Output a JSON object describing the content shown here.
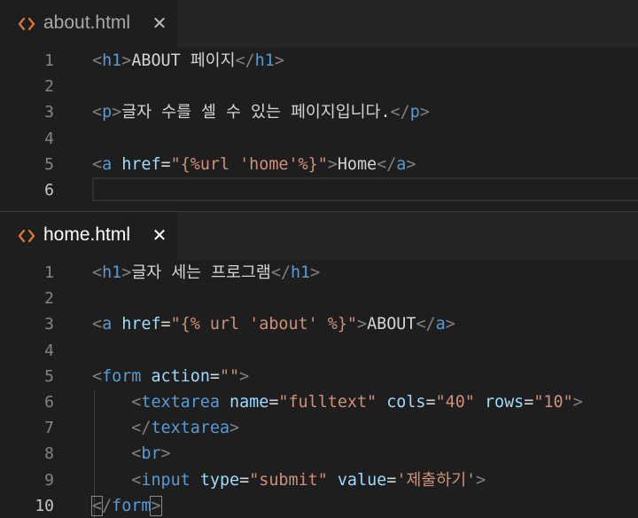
{
  "panes": [
    {
      "tab": {
        "title": "about.html",
        "icon": "code-icon",
        "close": "✕"
      },
      "lines": [
        {
          "num": "1",
          "tokens": [
            [
              "<",
              "punc"
            ],
            [
              "h1",
              "tag"
            ],
            [
              ">",
              "punc"
            ],
            [
              "ABOUT 페이지",
              "text"
            ],
            [
              "</",
              "punc"
            ],
            [
              "h1",
              "tag"
            ],
            [
              ">",
              "punc"
            ]
          ]
        },
        {
          "num": "2",
          "tokens": []
        },
        {
          "num": "3",
          "tokens": [
            [
              "<",
              "punc"
            ],
            [
              "p",
              "tag"
            ],
            [
              ">",
              "punc"
            ],
            [
              "글자 수를 셀 수 있는 페이지입니다.",
              "text"
            ],
            [
              "</",
              "punc"
            ],
            [
              "p",
              "tag"
            ],
            [
              ">",
              "punc"
            ]
          ]
        },
        {
          "num": "4",
          "tokens": []
        },
        {
          "num": "5",
          "tokens": [
            [
              "<",
              "punc"
            ],
            [
              "a",
              "tag"
            ],
            [
              " ",
              "text"
            ],
            [
              "href",
              "attr"
            ],
            [
              "=",
              "text"
            ],
            [
              "\"{%url 'home'%}\"",
              "str"
            ],
            [
              ">",
              "punc"
            ],
            [
              "Home",
              "text"
            ],
            [
              "</",
              "punc"
            ],
            [
              "a",
              "tag"
            ],
            [
              ">",
              "punc"
            ]
          ]
        },
        {
          "num": "6",
          "tokens": [],
          "current": true
        }
      ]
    },
    {
      "tab": {
        "title": "home.html",
        "icon": "code-icon",
        "close": "✕"
      },
      "lines": [
        {
          "num": "1",
          "tokens": [
            [
              "<",
              "punc"
            ],
            [
              "h1",
              "tag"
            ],
            [
              ">",
              "punc"
            ],
            [
              "글자 세는 프로그램",
              "text"
            ],
            [
              "</",
              "punc"
            ],
            [
              "h1",
              "tag"
            ],
            [
              ">",
              "punc"
            ]
          ]
        },
        {
          "num": "2",
          "tokens": []
        },
        {
          "num": "3",
          "tokens": [
            [
              "<",
              "punc"
            ],
            [
              "a",
              "tag"
            ],
            [
              " ",
              "text"
            ],
            [
              "href",
              "attr"
            ],
            [
              "=",
              "text"
            ],
            [
              "\"{% url 'about' %}\"",
              "str"
            ],
            [
              ">",
              "punc"
            ],
            [
              "ABOUT",
              "text"
            ],
            [
              "</",
              "punc"
            ],
            [
              "a",
              "tag"
            ],
            [
              ">",
              "punc"
            ]
          ]
        },
        {
          "num": "4",
          "tokens": []
        },
        {
          "num": "5",
          "tokens": [
            [
              "<",
              "punc"
            ],
            [
              "form",
              "tag"
            ],
            [
              " ",
              "text"
            ],
            [
              "action",
              "attr"
            ],
            [
              "=",
              "text"
            ],
            [
              "\"\"",
              "str"
            ],
            [
              ">",
              "punc"
            ]
          ]
        },
        {
          "num": "6",
          "tokens": [
            [
              "    ",
              "text"
            ],
            [
              "<",
              "punc"
            ],
            [
              "textarea",
              "tag"
            ],
            [
              " ",
              "text"
            ],
            [
              "name",
              "attr"
            ],
            [
              "=",
              "text"
            ],
            [
              "\"fulltext\"",
              "str"
            ],
            [
              " ",
              "text"
            ],
            [
              "cols",
              "attr"
            ],
            [
              "=",
              "text"
            ],
            [
              "\"40\"",
              "str"
            ],
            [
              " ",
              "text"
            ],
            [
              "rows",
              "attr"
            ],
            [
              "=",
              "text"
            ],
            [
              "\"10\"",
              "str"
            ],
            [
              ">",
              "punc"
            ]
          ]
        },
        {
          "num": "7",
          "tokens": [
            [
              "    ",
              "text"
            ],
            [
              "</",
              "punc"
            ],
            [
              "textarea",
              "tag"
            ],
            [
              ">",
              "punc"
            ]
          ]
        },
        {
          "num": "8",
          "tokens": [
            [
              "    ",
              "text"
            ],
            [
              "<",
              "punc"
            ],
            [
              "br",
              "tag"
            ],
            [
              ">",
              "punc"
            ]
          ]
        },
        {
          "num": "9",
          "tokens": [
            [
              "    ",
              "text"
            ],
            [
              "<",
              "punc"
            ],
            [
              "input",
              "tag"
            ],
            [
              " ",
              "text"
            ],
            [
              "type",
              "attr"
            ],
            [
              "=",
              "text"
            ],
            [
              "\"submit\"",
              "str"
            ],
            [
              " ",
              "text"
            ],
            [
              "value",
              "attr"
            ],
            [
              "=",
              "text"
            ],
            [
              "'제출하기'",
              "str"
            ],
            [
              ">",
              "punc"
            ]
          ]
        },
        {
          "num": "10",
          "tokens": [
            [
              "<",
              "punc",
              "bracket"
            ],
            [
              "/",
              "punc"
            ],
            [
              "form",
              "tag"
            ],
            [
              ">",
              "punc",
              "bracket"
            ]
          ],
          "current": true
        }
      ]
    }
  ],
  "colors": {
    "background": "#1e1e1e",
    "tag": "#569cd6",
    "attribute": "#9cdcfe",
    "string": "#ce9178",
    "punctuation": "#808080",
    "text": "#d4d4d4",
    "icon": "#e37933"
  }
}
